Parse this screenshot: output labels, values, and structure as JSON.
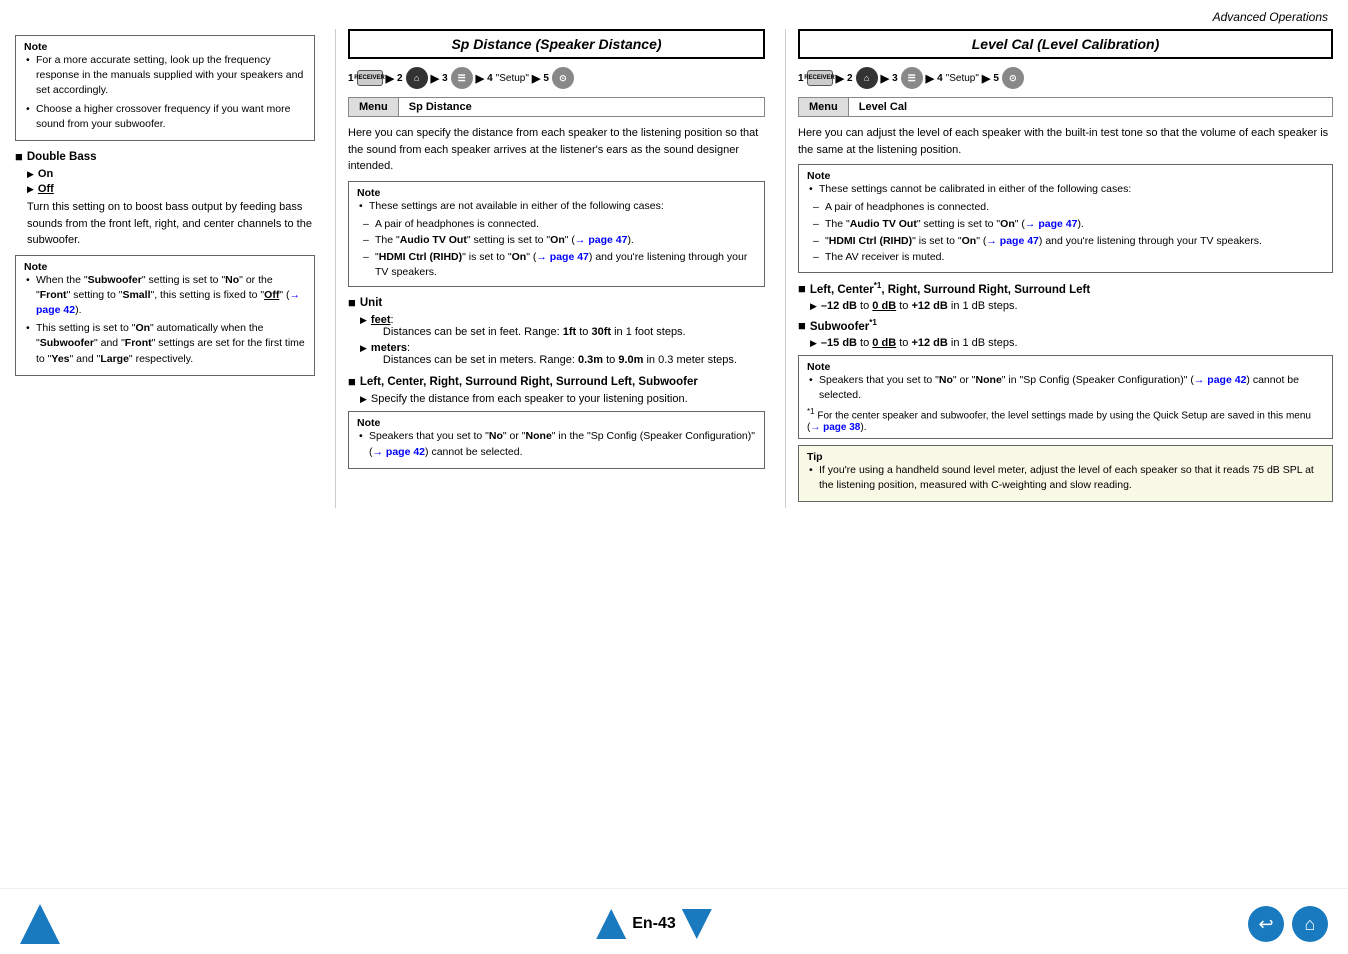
{
  "header": {
    "title": "Advanced Operations"
  },
  "footer": {
    "page_num": "En-43"
  },
  "left_col": {
    "note1": {
      "label": "Note",
      "items": [
        "For a more accurate setting, look up the frequency response in the manuals supplied with your speakers and set accordingly.",
        "Choose a higher crossover frequency if you want more sound from your subwoofer."
      ]
    },
    "double_bass": {
      "heading": "Double Bass",
      "on_label": "On",
      "off_label": "Off",
      "description": "Turn this setting on to boost bass output by feeding bass sounds from the front left, right, and center channels to the subwoofer."
    },
    "note2": {
      "label": "Note",
      "items": [
        {
          "text": "When the \"Subwoofer\" setting is set to \"No\" or the \"Front\" setting to \"Small\", this setting is fixed to \"Off\" (→ page 42)."
        },
        {
          "text": "This setting is set to \"On\" automatically when the \"Subwoofer\" and \"Front\" settings are set for the first time to \"Yes\" and \"Large\" respectively."
        }
      ]
    }
  },
  "mid_col": {
    "section_title": "Sp Distance (Speaker Distance)",
    "nav": {
      "steps": [
        "1",
        "2",
        "3",
        "4",
        "5"
      ],
      "setup_label": "\"Setup\""
    },
    "menu_bar": {
      "left": "Menu",
      "right": "Sp Distance"
    },
    "intro_text": "Here you can specify the distance from each speaker to the listening position so that the sound from each speaker arrives at the listener's ears as the sound designer intended.",
    "note1": {
      "label": "Note",
      "items": [
        "These settings are not available in either of the following cases:",
        "– A pair of headphones is connected.",
        "– The \"Audio TV Out\" setting is set to \"On\" (→ page 47).",
        "– \"HDMI Ctrl (RIHD)\" is set to \"On\" (→ page 47) and you're listening through your TV speakers."
      ]
    },
    "unit_heading": "Unit",
    "feet_label": "feet",
    "feet_desc": "Distances can be set in feet. Range: 1ft to 30ft in 1 foot steps.",
    "meters_label": "meters",
    "meters_desc": "Distances can be set in meters. Range: 0.3m to 9.0m in 0.3 meter steps.",
    "speakers_heading": "Left, Center, Right, Surround Right, Surround Left, Subwoofer",
    "speakers_desc": "Specify the distance from each speaker to your listening position.",
    "note2": {
      "label": "Note",
      "items": [
        "Speakers that you set to \"No\" or \"None\" in the \"Sp Config (Speaker Configuration)\" (→ page 42) cannot be selected."
      ]
    }
  },
  "right_col": {
    "section_title": "Level Cal (Level Calibration)",
    "nav": {
      "steps": [
        "1",
        "2",
        "3",
        "4",
        "5"
      ],
      "setup_label": "\"Setup\""
    },
    "menu_bar": {
      "left": "Menu",
      "right": "Level Cal"
    },
    "intro_text": "Here you can adjust the level of each speaker with the built-in test tone so that the volume of each speaker is the same at the listening position.",
    "note1": {
      "label": "Note",
      "items": [
        "These settings cannot be calibrated in either of the following cases:",
        "– A pair of headphones is connected.",
        "– The \"Audio TV Out\" setting is set to \"On\" (→ page 47).",
        "– \"HDMI Ctrl (RIHD)\" is set to \"On\" (→ page 47) and you're listening through your TV speakers.",
        "– The AV receiver is muted."
      ]
    },
    "left_center_heading": "Left, Center*1, Right, Surround Right, Surround Left",
    "left_center_range": "–12 dB to 0 dB to +12 dB in 1 dB steps.",
    "subwoofer_heading": "Subwoofer*1",
    "subwoofer_range": "–15 dB to 0 dB to +12 dB in 1 dB steps.",
    "note2": {
      "label": "Note",
      "items": [
        "Speakers that you set to \"No\" or \"None\" in \"Sp Config (Speaker Configuration)\" (→ page 42) cannot be selected.",
        "*1  For the center speaker and subwoofer, the level settings made by using the Quick Setup are saved in this menu (→ page 38)."
      ]
    },
    "tip": {
      "label": "Tip",
      "text": "If you're using a handheld sound level meter, adjust the level of each speaker so that it reads 75 dB SPL at the listening position, measured with C-weighting and slow reading."
    }
  }
}
